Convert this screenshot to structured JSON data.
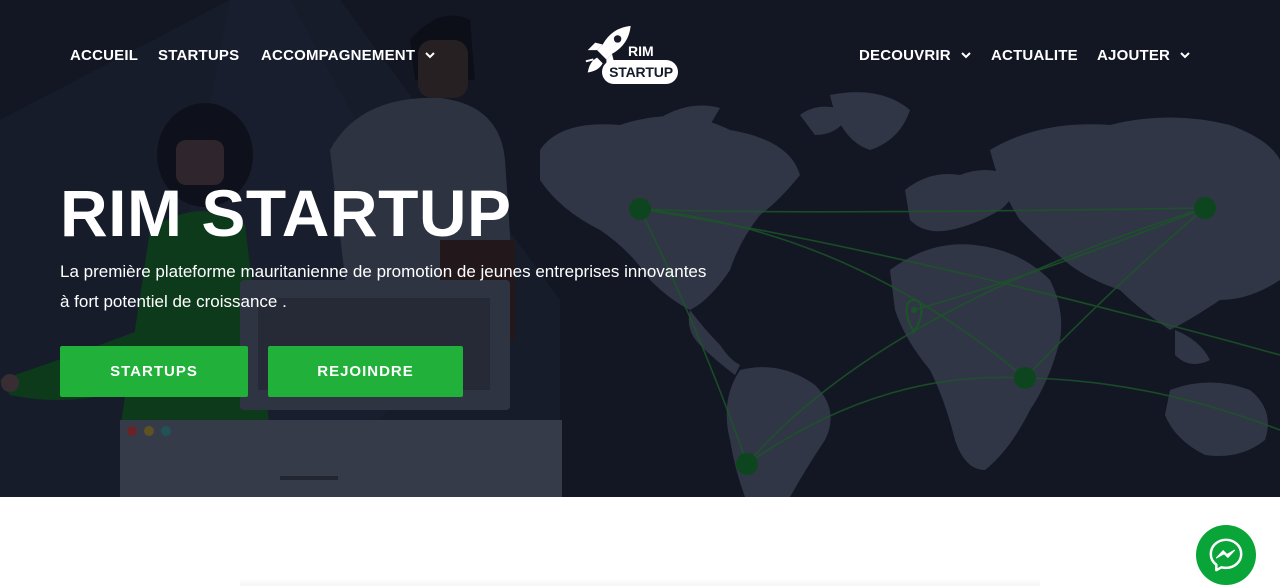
{
  "nav": {
    "left": [
      {
        "label": "ACCUEIL"
      },
      {
        "label": "STARTUPS"
      },
      {
        "label": "ACCOMPAGNEMENT"
      }
    ],
    "right": [
      {
        "label": "DECOUVRIR"
      },
      {
        "label": "ACTUALITE"
      },
      {
        "label": "AJOUTER"
      }
    ]
  },
  "logo": {
    "line1": "RIM",
    "line2": "STARTUP",
    "icon": "rocket-icon"
  },
  "hero": {
    "title": "RIM STARTUP",
    "subtitle": "La première plateforme mauritanienne de promotion de jeunes entreprises innovantes à fort potentiel de croissance .",
    "buttons": [
      {
        "label": "STARTUPS"
      },
      {
        "label": "REJOINDRE"
      }
    ]
  },
  "messenger": {
    "icon": "messenger-icon"
  },
  "colors": {
    "accent": "#21b03a",
    "hero_bg": "#161c2a",
    "messenger": "#0aa539"
  }
}
